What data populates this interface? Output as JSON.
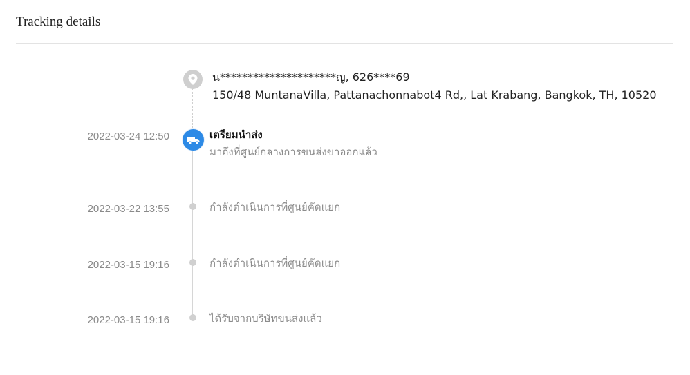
{
  "header": {
    "title": "Tracking details"
  },
  "address": {
    "icon": "location-pin-icon",
    "name_phone": "น*********************ญ,  626****69",
    "line": "150/48 MuntanaVilla, Pattanachonnabot4 Rd,,  Lat Krabang,  Bangkok,  TH,  10520"
  },
  "events": [
    {
      "time": "2022-03-24 12:50",
      "title": "เตรียมนำส่ง",
      "desc": "มาถึงที่ศูนย์กลางการขนส่งขาออกแล้ว",
      "icon": "delivery-truck-icon",
      "active": true
    },
    {
      "time": "2022-03-22 13:55",
      "desc": "กำลังดำเนินการที่ศูนย์คัดแยก"
    },
    {
      "time": "2022-03-15 19:16",
      "desc": "กำลังดำเนินการที่ศูนย์คัดแยก"
    },
    {
      "time": "2022-03-15 19:16",
      "desc": "ได้รับจากบริษัทขนส่งแล้ว"
    }
  ],
  "colors": {
    "active": "#2d8ae6",
    "inactive_dot": "#d0d0d0",
    "muted_text": "#8c8c8c"
  }
}
